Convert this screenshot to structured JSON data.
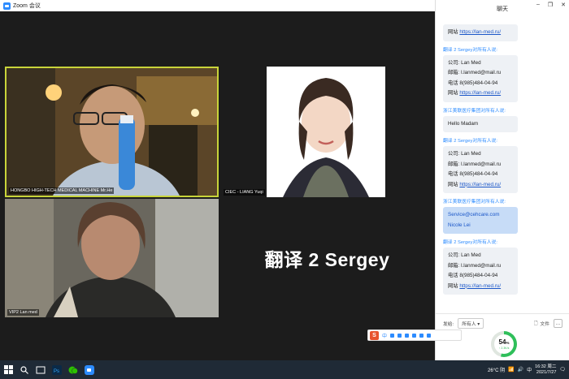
{
  "window": {
    "title": "Zoom 会议"
  },
  "videos": [
    {
      "name": "HONGBO HIGH-TECH MEDICAL MACHINE Mr.He"
    },
    {
      "name": "CIEC - LIANG Yuqi"
    },
    {
      "name": "VIP2 Lan med"
    },
    {
      "name": "翻译 2 Sergey",
      "display": "翻译 2 Sergey"
    }
  ],
  "chat": {
    "title": "聊天",
    "messages": [
      {
        "lines": [
          [
            "网站",
            "https://lan-med.ru/"
          ]
        ]
      },
      {
        "sender": "翻译 2 Sergey对所有人说:",
        "lines": [
          [
            "公司:",
            "Lan Med"
          ],
          [
            "邮箱:",
            "l.lanmed@mail.ru"
          ],
          [
            "电话",
            "8(985)484-04-94"
          ],
          [
            "网站",
            "https://lan-med.ru/"
          ]
        ]
      },
      {
        "sender": "浙江美联医疗集团对所有人说:",
        "text": "Hello Madam"
      },
      {
        "sender": "翻译 2 Sergey对所有人说:",
        "lines": [
          [
            "公司:",
            "Lan Med"
          ],
          [
            "邮箱:",
            "l.lanmed@mail.ru"
          ],
          [
            "电话",
            "8(985)484-04-94"
          ],
          [
            "网站",
            "https://lan-med.ru/"
          ]
        ]
      },
      {
        "sender": "浙江美联医疗集团对所有人说:",
        "text": "Service@cehcare.com Nicole Lei",
        "selected": true
      },
      {
        "sender": "翻译 2 Sergey对所有人说:",
        "lines": [
          [
            "公司:",
            "Lan Med"
          ],
          [
            "邮箱:",
            "l.lanmed@mail.ru"
          ],
          [
            "电话",
            "8(985)484-04-94"
          ],
          [
            "网站",
            "https://lan-med.ru/"
          ]
        ]
      }
    ],
    "send_to_label": "发给:",
    "recipient": "所有人",
    "file_label": "文件"
  },
  "net": {
    "percent": "54",
    "unit": "%",
    "speed": "↑ 2.3K/s"
  },
  "ime": {
    "mode": "中"
  },
  "taskbar": {
    "weather": "26°C 阴",
    "time": "16:32 周二",
    "date": "2021/7/27",
    "lang": "中"
  },
  "colors": {
    "accent": "#2d8cff",
    "highlight": "#c8d43a",
    "gauge": "#2fbf5a"
  }
}
